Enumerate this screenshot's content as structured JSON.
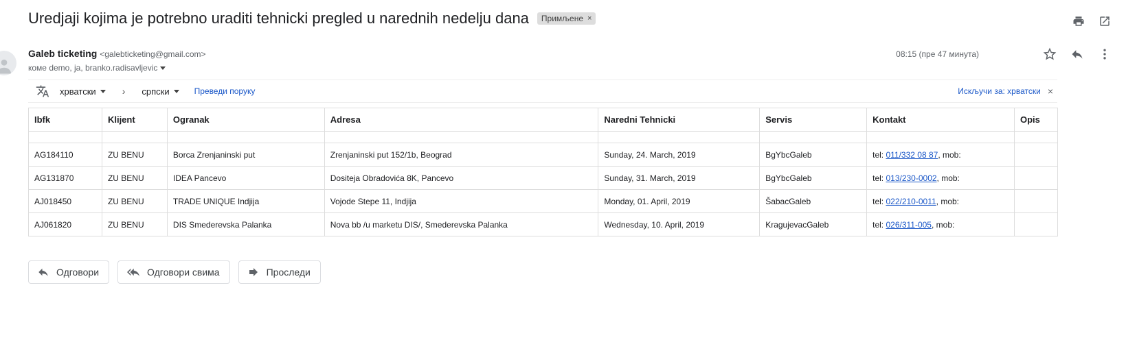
{
  "subject": "Uredjaji kojima je potrebno uraditi tehnicki pregled u narednih nedelju dana",
  "label": "Примљене",
  "label_close": "×",
  "sender": {
    "name": "Galeb ticketing",
    "email": "<galebticketing@gmail.com>",
    "recipients": "коме demo, ja, branko.radisavljevic"
  },
  "time": "08:15 (пре 47 минута)",
  "translate": {
    "from": "хрватски",
    "to": "српски",
    "chevron": "›",
    "translate_link": "Преведи поруку",
    "turn_off": "Искључи за: хрватски",
    "close": "×"
  },
  "table": {
    "headers": [
      "Ibfk",
      "Klijent",
      "Ogranak",
      "Adresa",
      "Naredni Tehnicki",
      "Servis",
      "Kontakt",
      "Opis"
    ],
    "rows": [
      {
        "ibfk": "AG184110",
        "klijent": "ZU BENU",
        "ogranak": "Borca Zrenjaninski put",
        "adresa": "Zrenjaninski put 152/1b, Beograd",
        "datum": "Sunday, 24. March, 2019",
        "servis": "BgYbcGaleb",
        "tel_prefix": "tel: ",
        "tel": "011/332 08 87",
        "mob": ", mob:",
        "opis": ""
      },
      {
        "ibfk": "AG131870",
        "klijent": "ZU BENU",
        "ogranak": "IDEA Pancevo",
        "adresa": "Dositeja Obradovića 8K, Pancevo",
        "datum": "Sunday, 31. March, 2019",
        "servis": "BgYbcGaleb",
        "tel_prefix": "tel: ",
        "tel": "013/230-0002",
        "mob": ", mob:",
        "opis": ""
      },
      {
        "ibfk": "AJ018450",
        "klijent": "ZU BENU",
        "ogranak": "TRADE UNIQUE Indjija",
        "adresa": "Vojode Stepe 11, Indjija",
        "datum": "Monday, 01. April, 2019",
        "servis": "ŠabacGaleb",
        "tel_prefix": "tel: ",
        "tel": "022/210-0011",
        "mob": ", mob:",
        "opis": ""
      },
      {
        "ibfk": "AJ061820",
        "klijent": "ZU BENU",
        "ogranak": "DIS Smederevska Palanka",
        "adresa": "Nova bb /u marketu DIS/, Smederevska Palanka",
        "datum": "Wednesday, 10. April, 2019",
        "servis": "KragujevacGaleb",
        "tel_prefix": "tel: ",
        "tel": "026/311-005",
        "mob": ", mob:",
        "opis": ""
      }
    ]
  },
  "buttons": {
    "reply": "Одговори",
    "reply_all": "Одговори свима",
    "forward": "Проследи"
  },
  "icons": [
    "print-icon",
    "open-in-new-icon",
    "star-icon",
    "reply-icon",
    "more-vert-icon",
    "translate-icon",
    "person-icon"
  ]
}
